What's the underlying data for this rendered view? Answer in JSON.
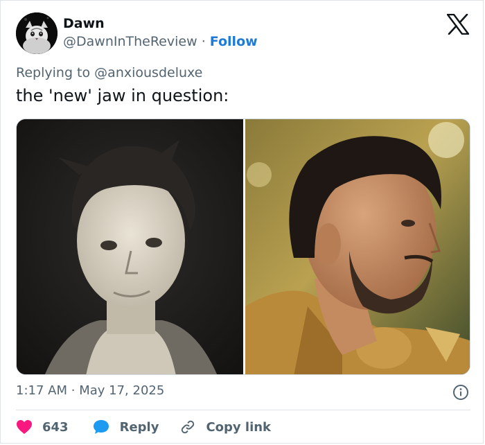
{
  "author": {
    "name": "Dawn",
    "handle": "@DawnInTheReview",
    "separator": "·",
    "follow_label": "Follow"
  },
  "reply_context": {
    "prefix": "Replying to",
    "mention": "@anxiousdeluxe"
  },
  "tweet": {
    "text": "the 'new' jaw in question:"
  },
  "meta": {
    "time": "1:17 AM",
    "separator": "·",
    "date": "May 17, 2025"
  },
  "actions": {
    "like_count": "643",
    "reply_label": "Reply",
    "copy_link_label": "Copy link"
  },
  "colors": {
    "like": "#f91880",
    "reply": "#1d9bf0",
    "follow": "#1d7bd8",
    "secondary_text": "#536471"
  },
  "icons": {
    "brand": "x-logo-icon",
    "info": "info-icon",
    "like": "heart-icon",
    "reply": "speech-bubble-icon",
    "copy": "link-icon"
  }
}
